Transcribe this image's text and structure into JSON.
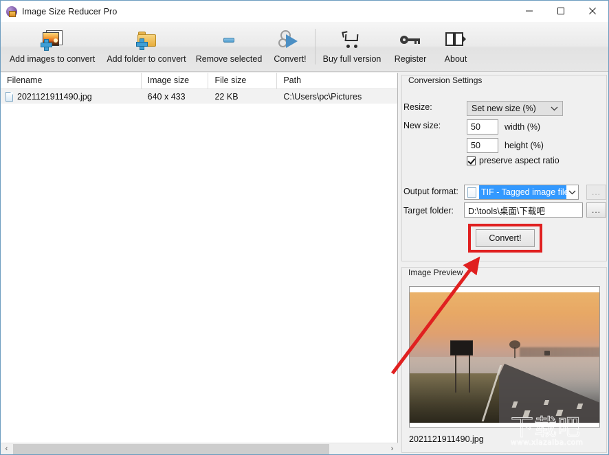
{
  "window": {
    "title": "Image Size Reducer Pro",
    "app_icon": "app-icon",
    "minimize": "—",
    "maximize": "☐",
    "close": "✕"
  },
  "toolbar": {
    "items": [
      {
        "label": "Add images to convert",
        "icon": "add-image-icon"
      },
      {
        "label": "Add folder to convert",
        "icon": "add-folder-icon"
      },
      {
        "label": "Remove selected",
        "icon": "remove-icon"
      },
      {
        "label": "Convert!",
        "icon": "convert-gears-icon"
      },
      {
        "label": "Buy full version",
        "icon": "shopping-cart-icon"
      },
      {
        "label": "Register",
        "icon": "key-icon"
      },
      {
        "label": "About",
        "icon": "book-icon"
      }
    ]
  },
  "file_list": {
    "columns": [
      "Filename",
      "Image size",
      "File size",
      "Path"
    ],
    "rows": [
      {
        "filename": "2021121911490.jpg",
        "image_size": "640 x 433",
        "file_size": "22 KB",
        "path": "C:\\Users\\pc\\Pictures"
      }
    ],
    "scrollbar": {
      "left_arrow": "‹",
      "right_arrow": "›"
    }
  },
  "settings": {
    "legend": "Conversion Settings",
    "resize_label": "Resize:",
    "resize_value": "Set new size (%)",
    "new_size_label": "New size:",
    "width_value": "50",
    "width_unit": "width  (%)",
    "height_value": "50",
    "height_unit": "height (%)",
    "preserve_aspect_label": "preserve aspect ratio",
    "preserve_aspect_checked": true,
    "output_format_label": "Output format:",
    "output_format_value": "TIF - Tagged image file",
    "output_format_browse": "...",
    "target_folder_label": "Target folder:",
    "target_folder_value": "D:\\tools\\桌面\\下载吧",
    "target_folder_browse": "...",
    "convert_button": "Convert!",
    "chevron": "⌄"
  },
  "preview": {
    "legend": "Image Preview",
    "filename": "2021121911490.jpg"
  },
  "annotation": {
    "highlight_color": "#e02020",
    "arrow_color": "#e02020",
    "target": "Convert!"
  },
  "watermark": {
    "text_cn": "下载吧",
    "text_url": "www.xiazaiba.com"
  }
}
